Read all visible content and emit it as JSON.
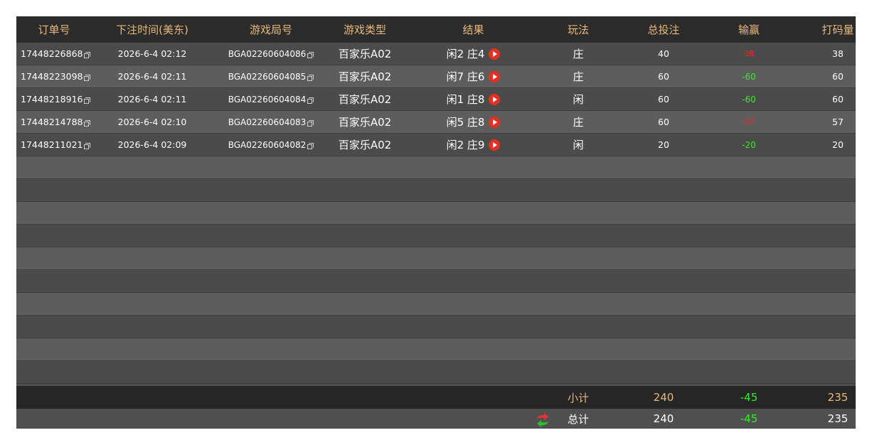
{
  "columns": [
    "订单号",
    "下注时间(美东)",
    "游戏局号",
    "游戏类型",
    "结果",
    "玩法",
    "总投注",
    "输赢",
    "打码量"
  ],
  "rows": [
    {
      "order": "17448226868",
      "time": "2026-6-4 02:12",
      "round": "BGA02260604086",
      "game": "百家乐A02",
      "result": "闲2 庄4",
      "play": "庄",
      "bet": "40",
      "winlose": "38",
      "winlose_color": "red",
      "turnover": "38"
    },
    {
      "order": "17448223098",
      "time": "2026-6-4 02:11",
      "round": "BGA02260604085",
      "game": "百家乐A02",
      "result": "闲7 庄6",
      "play": "庄",
      "bet": "60",
      "winlose": "-60",
      "winlose_color": "green",
      "turnover": "60"
    },
    {
      "order": "17448218916",
      "time": "2026-6-4 02:11",
      "round": "BGA02260604084",
      "game": "百家乐A02",
      "result": "闲1 庄8",
      "play": "闲",
      "bet": "60",
      "winlose": "-60",
      "winlose_color": "green",
      "turnover": "60"
    },
    {
      "order": "17448214788",
      "time": "2026-6-4 02:10",
      "round": "BGA02260604083",
      "game": "百家乐A02",
      "result": "闲5 庄8",
      "play": "庄",
      "bet": "60",
      "winlose": "57",
      "winlose_color": "red",
      "turnover": "57"
    },
    {
      "order": "17448211021",
      "time": "2026-6-4 02:09",
      "round": "BGA02260604082",
      "game": "百家乐A02",
      "result": "闲2 庄9",
      "play": "闲",
      "bet": "20",
      "winlose": "-20",
      "winlose_color": "green",
      "turnover": "20"
    }
  ],
  "subtotal": {
    "label": "小计",
    "bet": "240",
    "winlose": "-45",
    "turnover": "235"
  },
  "total": {
    "label": "总计",
    "bet": "240",
    "winlose": "-45",
    "turnover": "235"
  },
  "colors": {
    "header_text": "#e8b97b",
    "loss": "#33ee22",
    "win": "#ff2020",
    "play_icon": "#e0321f"
  },
  "icons": {
    "copy": "copy-icon",
    "play": "play-icon",
    "refresh": "refresh-icon"
  }
}
